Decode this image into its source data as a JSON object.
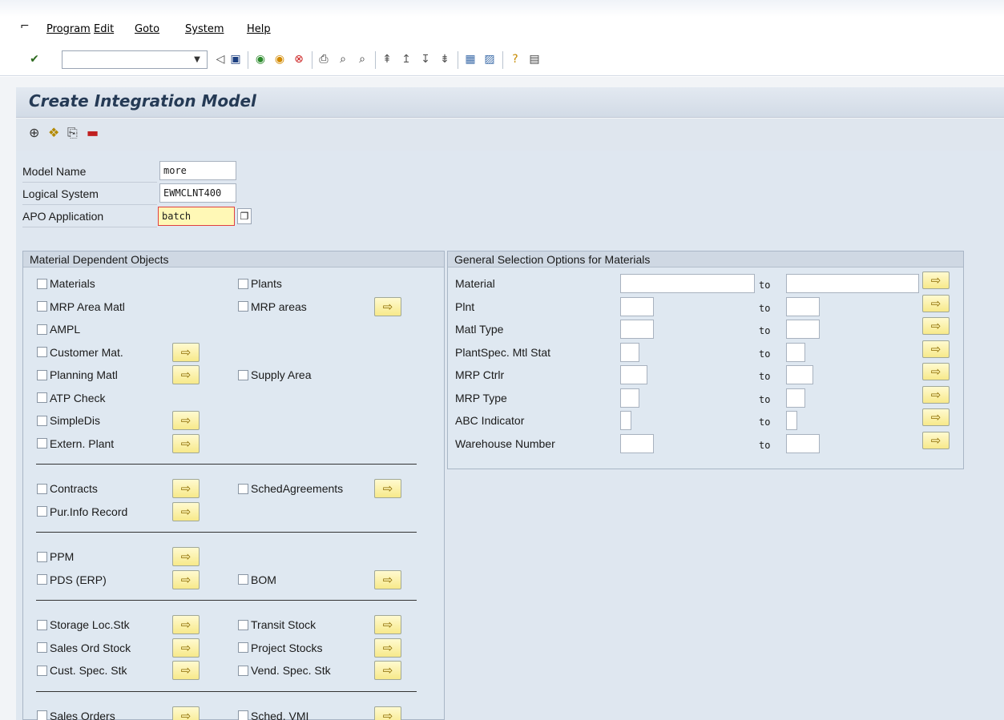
{
  "menu": {
    "items": [
      "Program",
      "Edit",
      "Goto",
      "System",
      "Help"
    ]
  },
  "toolbar": {
    "command_value": ""
  },
  "page": {
    "title": "Create Integration Model"
  },
  "fields": {
    "model_name": {
      "label": "Model Name",
      "value": "more"
    },
    "logical_system": {
      "label": "Logical System",
      "value": "EWMCLNT400"
    },
    "apo_application": {
      "label": "APO Application",
      "value": "batch"
    }
  },
  "material_dependent": {
    "header": "Material Dependent Objects",
    "sections": [
      {
        "rows": [
          {
            "left": "Materials",
            "left_arrow": false,
            "right": "Plants",
            "right_arrow": false
          },
          {
            "left": "MRP Area Matl",
            "left_arrow": false,
            "right": "MRP areas",
            "right_arrow": true
          },
          {
            "left": "AMPL",
            "left_arrow": false,
            "right": "",
            "right_arrow": false
          },
          {
            "left": "Customer Mat.",
            "left_arrow": true,
            "right": "",
            "right_arrow": false
          },
          {
            "left": "Planning Matl",
            "left_arrow": true,
            "right": "Supply Area",
            "right_arrow": false
          },
          {
            "left": "ATP Check",
            "left_arrow": false,
            "right": "",
            "right_arrow": false
          },
          {
            "left": "SimpleDis",
            "left_arrow": true,
            "right": "",
            "right_arrow": false
          },
          {
            "left": "Extern. Plant",
            "left_arrow": true,
            "right": "",
            "right_arrow": false
          }
        ]
      },
      {
        "rows": [
          {
            "left": "Contracts",
            "left_arrow": true,
            "right": "SchedAgreements",
            "right_arrow": true
          },
          {
            "left": "Pur.Info Record",
            "left_arrow": true,
            "right": "",
            "right_arrow": false
          }
        ]
      },
      {
        "rows": [
          {
            "left": "PPM",
            "left_arrow": true,
            "right": "",
            "right_arrow": false
          },
          {
            "left": "PDS (ERP)",
            "left_arrow": true,
            "right": "BOM",
            "right_arrow": true
          }
        ]
      },
      {
        "rows": [
          {
            "left": "Storage Loc.Stk",
            "left_arrow": true,
            "right": "Transit Stock",
            "right_arrow": true
          },
          {
            "left": "Sales Ord Stock",
            "left_arrow": true,
            "right": "Project Stocks",
            "right_arrow": true
          },
          {
            "left": "Cust. Spec. Stk",
            "left_arrow": true,
            "right": "Vend. Spec. Stk",
            "right_arrow": true
          }
        ]
      },
      {
        "rows": [
          {
            "left": "Sales Orders",
            "left_arrow": true,
            "right": "Sched. VMI",
            "right_arrow": true
          }
        ]
      }
    ]
  },
  "general_selection": {
    "header": "General Selection Options for Materials",
    "to_label": "to",
    "rows": [
      {
        "label": "Material",
        "from": "",
        "to": ""
      },
      {
        "label": "Plnt",
        "from": "",
        "to": ""
      },
      {
        "label": "Matl Type",
        "from": "",
        "to": ""
      },
      {
        "label": "PlantSpec. Mtl Stat",
        "from": "",
        "to": ""
      },
      {
        "label": "MRP Ctrlr",
        "from": "",
        "to": ""
      },
      {
        "label": "MRP Type",
        "from": "",
        "to": ""
      },
      {
        "label": "ABC Indicator",
        "from": "",
        "to": ""
      },
      {
        "label": "Warehouse Number",
        "from": "",
        "to": ""
      }
    ]
  }
}
